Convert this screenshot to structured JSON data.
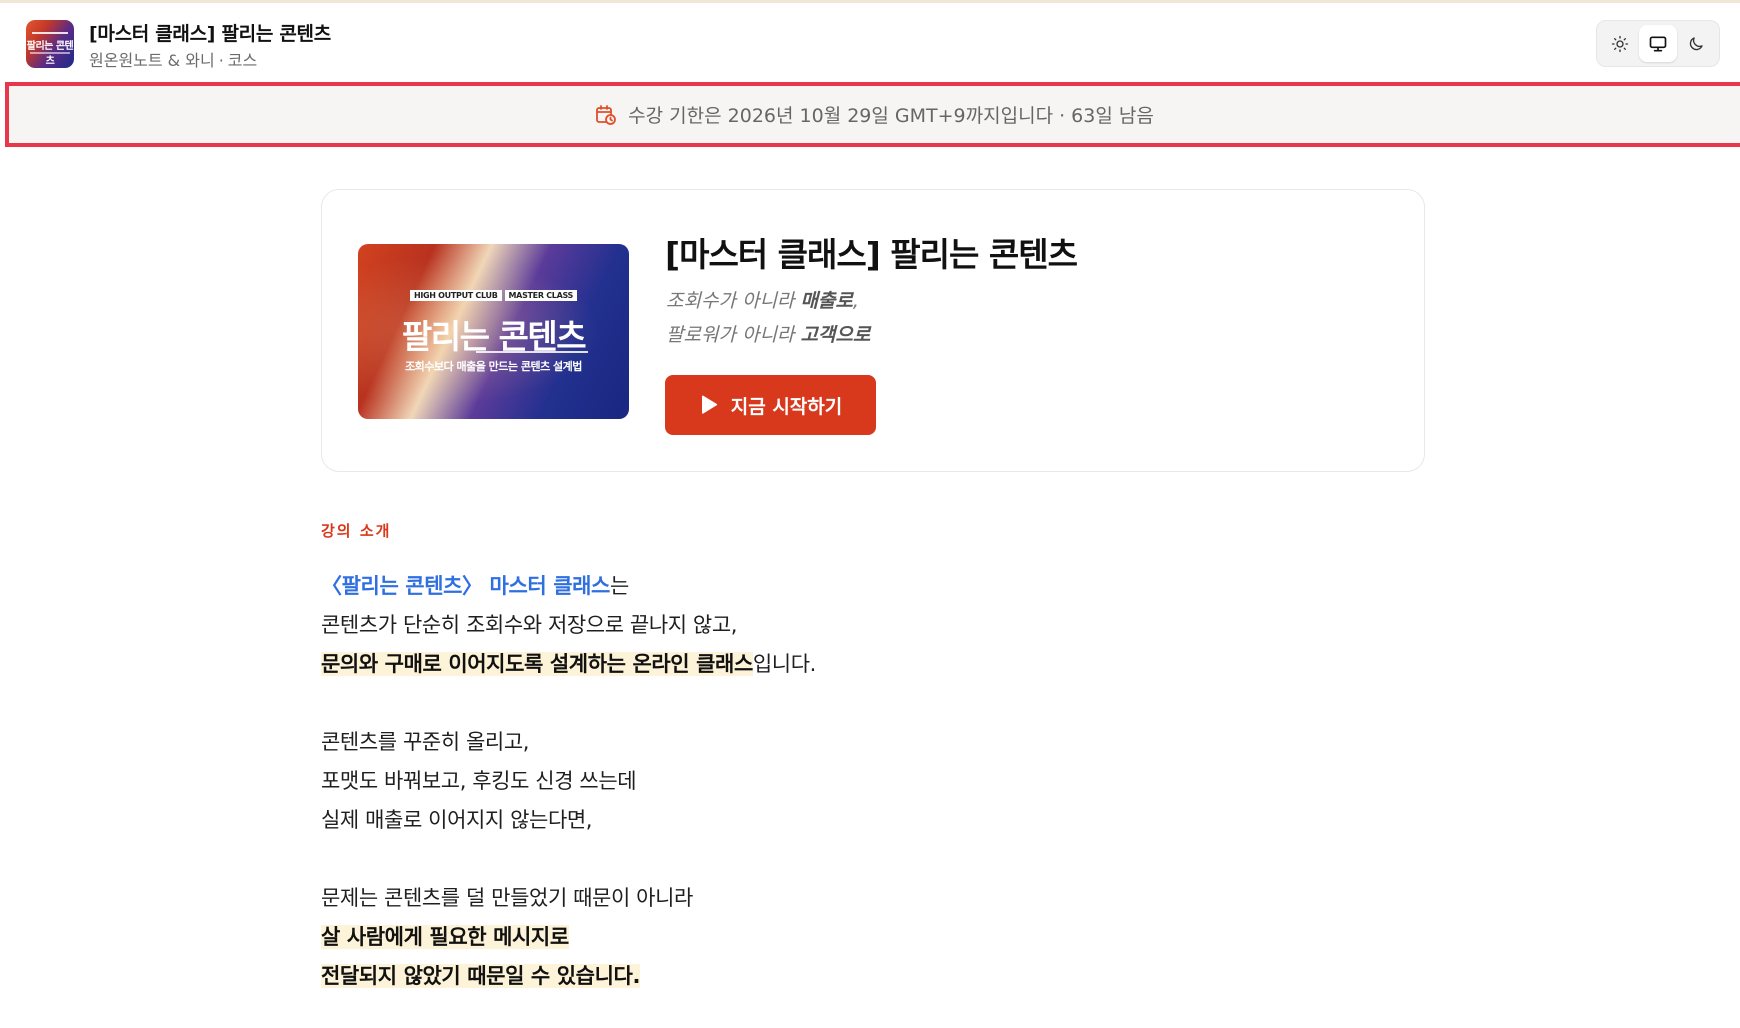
{
  "header": {
    "app_title": "[마스터 클래스] 팔리는 콘텐츠",
    "author": "원온원노트 & 와니",
    "separator": "·",
    "type": "코스",
    "logo_text": "팔리는 콘텐츠",
    "theme_options": [
      {
        "name": "light",
        "icon": "sun-icon",
        "selected": false
      },
      {
        "name": "system",
        "icon": "monitor-icon",
        "selected": true
      },
      {
        "name": "dark",
        "icon": "moon-icon",
        "selected": false
      }
    ]
  },
  "notice": {
    "icon": "calendar-clock-icon",
    "text": "수강 기한은 2026년 10월 29일 GMT+9까지입니다 · 63일 남음",
    "border_color": "#e8374a"
  },
  "course": {
    "thumbnail": {
      "tag1": "HIGH OUTPUT CLUB",
      "tag2": "MASTER CLASS",
      "title": "팔리는 콘텐츠",
      "subtitle": "조회수보다 매출을 만드는 콘텐츠 설계법"
    },
    "title": "[마스터 클래스] 팔리는 콘텐츠",
    "tagline1_prefix": "조회수가 아니라 ",
    "tagline1_bold": "매출로",
    "tagline1_suffix": ",",
    "tagline2_prefix": "팔로워가 아니라 ",
    "tagline2_bold": "고객으로",
    "start_button": "지금 시작하기",
    "accent_color": "#d8391c"
  },
  "intro": {
    "section_label": "강의 소개",
    "l1_link": "〈팔리는 콘텐츠〉 마스터 클래스",
    "l1_suffix": "는",
    "l2": "콘텐츠가 단순히 조회수와 저장으로 끝나지 않고,",
    "l3_highlight": "문의와 구매로 이어지도록 설계하는 온라인 클래스",
    "l3_suffix": "입니다.",
    "l4": "콘텐츠를 꾸준히 올리고,",
    "l5": "포맷도 바꿔보고, 후킹도 신경 쓰는데",
    "l6": "실제 매출로 이어지지 않는다면,",
    "l7": "문제는 콘텐츠를 덜 만들었기 때문이 아니라",
    "l8_highlight": "살 사람에게 필요한 메시지로",
    "l9_highlight": "전달되지 않았기 때문일 수 있습니다."
  }
}
